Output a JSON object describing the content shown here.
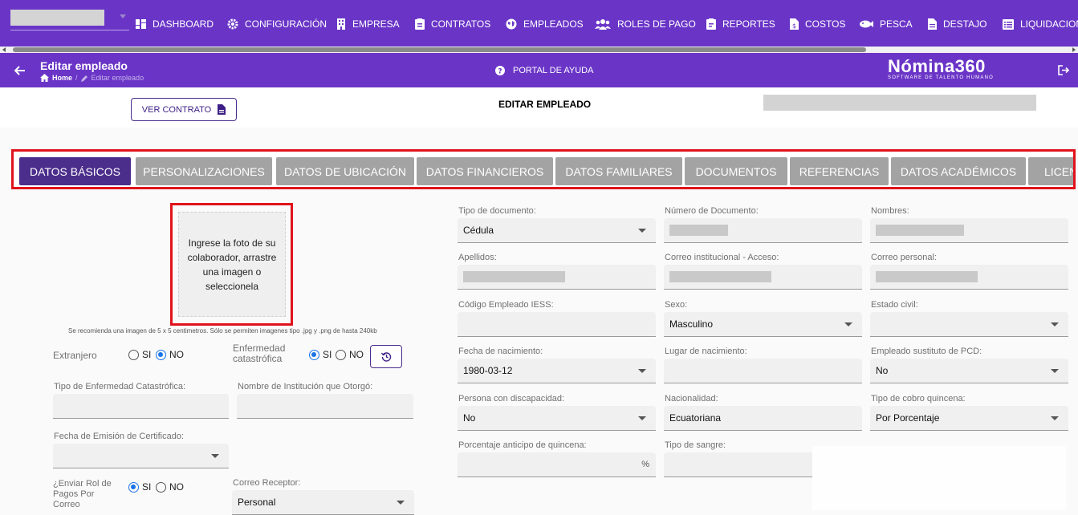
{
  "nav": {
    "items": [
      {
        "label": "DASHBOARD",
        "icon": "dashboard-icon"
      },
      {
        "label": "CONFIGURACIÓN",
        "icon": "gear-icon"
      },
      {
        "label": "EMPRESA",
        "icon": "building-icon"
      },
      {
        "label": "CONTRATOS",
        "icon": "contract-icon"
      },
      {
        "label": "EMPLEADOS",
        "icon": "globe-icon"
      },
      {
        "label": "ROLES DE PAGO",
        "icon": "users-icon"
      },
      {
        "label": "REPORTES",
        "icon": "report-icon"
      },
      {
        "label": "COSTOS",
        "icon": "dollar-file-icon"
      },
      {
        "label": "PESCA",
        "icon": "fish-icon"
      },
      {
        "label": "DESTAJO",
        "icon": "document-icon"
      },
      {
        "label": "LIQUIDACION",
        "icon": "list-icon"
      }
    ]
  },
  "header": {
    "title": "Editar empleado",
    "breadcrumb_home": "Home",
    "breadcrumb_current": "Editar empleado",
    "help": "PORTAL DE AYUDA",
    "logo_main": "Nómina360",
    "logo_sub": "SOFTWARE DE TALENTO HUMANO"
  },
  "toolbar": {
    "ver_contrato": "VER CONTRATO",
    "heading": "EDITAR EMPLEADO"
  },
  "tabs": [
    "DATOS BÁSICOS",
    "PERSONALIZACIONES",
    "DATOS DE UBICACIÓN",
    "DATOS FINANCIEROS",
    "DATOS FAMILIARES",
    "DOCUMENTOS",
    "REFERENCIAS",
    "DATOS ACADÉMICOS",
    "LICEN"
  ],
  "photo": {
    "prompt": "Ingrese la foto de su colaborador, arrastre una imagen o seleccionela",
    "hint": "Se recomienda una imagen de 5 x 5 centimetros. Sólo se permiten imagenes tipo .jpg y .png de hasta 240kb"
  },
  "left": {
    "extranjero": "Extranjero",
    "enfermedad": "Enfermedad catastrófica",
    "si": "SI",
    "no": "NO",
    "tipo_enfermedad": "Tipo de Enfermedad Catastrófica:",
    "institucion": "Nombre de Institución que Otorgó:",
    "fecha_emision": "Fecha de Emisión de Certificado:",
    "enviar_rol": "¿Enviar Rol de Pagos Por Correo",
    "correo_receptor": "Correo Receptor:",
    "correo_receptor_value": "Personal"
  },
  "form": {
    "tipo_documento": {
      "label": "Tipo de documento:",
      "value": "Cédula"
    },
    "numero_documento": {
      "label": "Número de Documento:"
    },
    "nombres": {
      "label": "Nombres:"
    },
    "apellidos": {
      "label": "Apellidos:"
    },
    "correo_institucional": {
      "label": "Correo institucional - Acceso:"
    },
    "correo_personal": {
      "label": "Correo personal:"
    },
    "codigo_iess": {
      "label": "Código Empleado IESS:"
    },
    "sexo": {
      "label": "Sexo:",
      "value": "Masculino"
    },
    "estado_civil": {
      "label": "Estado civil:"
    },
    "fecha_nacimiento": {
      "label": "Fecha de nacimiento:",
      "value": "1980-03-12"
    },
    "lugar_nacimiento": {
      "label": "Lugar de nacimiento:"
    },
    "sustituto_pcd": {
      "label": "Empleado sustituto de PCD:",
      "value": "No"
    },
    "discapacidad": {
      "label": "Persona con discapacidad:",
      "value": "No"
    },
    "nacionalidad": {
      "label": "Nacionalidad:",
      "value": "Ecuatoriana"
    },
    "cobro_quincena": {
      "label": "Tipo de cobro quincena:",
      "value": "Por Porcentaje"
    },
    "porcentaje_anticipo": {
      "label": "Porcentaje anticipo de quincena:",
      "suffix": "%"
    },
    "tipo_sangre": {
      "label": "Tipo de sangre:"
    }
  }
}
